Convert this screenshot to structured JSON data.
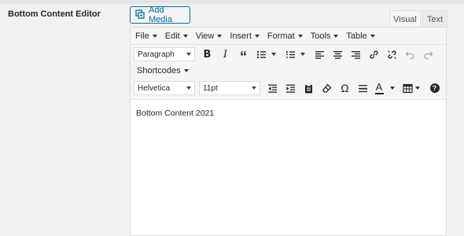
{
  "field_label": "Bottom Content Editor",
  "add_media": {
    "label": "Add Media",
    "icon": "add-media-icon"
  },
  "tabs": {
    "visual": "Visual",
    "text": "Text"
  },
  "menubar": [
    "File",
    "Edit",
    "View",
    "Insert",
    "Format",
    "Tools",
    "Table"
  ],
  "toolbar": {
    "format_select": "Paragraph",
    "shortcodes": "Shortcodes",
    "font_family": "Helvetica",
    "font_size": "11pt",
    "italic_glyph": "I",
    "bold_glyph": "B",
    "quote_glyph": "“",
    "omega_glyph": "Ω",
    "help_glyph": "?",
    "text_color_glyph": "A"
  },
  "content": {
    "text": "Bottom Content 2021"
  },
  "colors": {
    "accent": "#0071a1"
  }
}
